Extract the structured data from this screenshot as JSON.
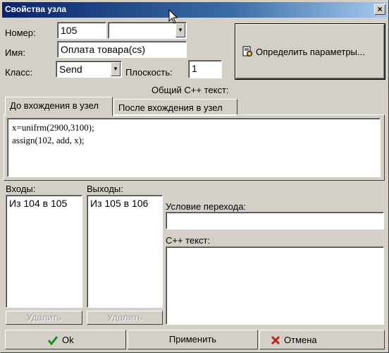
{
  "window": {
    "title": "Свойства узла",
    "close_label": "×"
  },
  "fields": {
    "number_label": "Номер:",
    "number_value": "105",
    "number_combo_value": "",
    "name_label": "Имя:",
    "name_value": "Оплата товара(cs)",
    "class_label": "Класс:",
    "class_value": "Send",
    "plane_label": "Плоскость:",
    "plane_value": "1"
  },
  "params_button": {
    "label": "Определить параметры..."
  },
  "common_text_label": "Общий C++ текст:",
  "tabs": [
    {
      "label": "До вхождения в узел",
      "active": true
    },
    {
      "label": "После вхождения в узел",
      "active": false
    }
  ],
  "code": "x=unifrm(2900,3100);\nassign(102, add, x);",
  "inputs": {
    "label": "Входы:",
    "items": [
      "Из 104 в 105"
    ],
    "delete_label": "Удалить"
  },
  "outputs": {
    "label": "Выходы:",
    "items": [
      "Из 105 в 106"
    ],
    "delete_label": "Удалить"
  },
  "transition": {
    "label": "Условие перехода:",
    "value": ""
  },
  "cpp_text": {
    "label": "C++ текст:",
    "value": ""
  },
  "footer": {
    "ok_label": "Ok",
    "apply_label": "Применить",
    "cancel_label": "Отмена"
  },
  "colors": {
    "titlebar_start": "#0a246a",
    "titlebar_end": "#a6caf0",
    "ok_check": "#1a8f1a",
    "cancel_x": "#c02020"
  }
}
